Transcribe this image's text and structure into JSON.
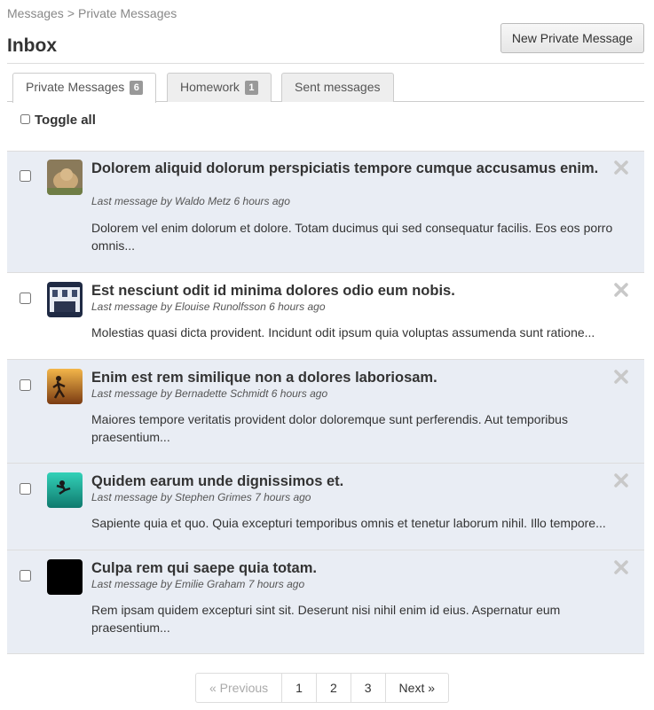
{
  "breadcrumb": {
    "parent": "Messages",
    "separator": ">",
    "current": "Private Messages"
  },
  "page_title": "Inbox",
  "new_button_label": "New Private Message",
  "tabs": [
    {
      "label": "Private Messages",
      "count": "6",
      "active": true
    },
    {
      "label": "Homework",
      "count": "1",
      "active": false
    },
    {
      "label": "Sent messages",
      "count": "",
      "active": false
    }
  ],
  "toggle_all_label": "Toggle all",
  "messages": [
    {
      "title": "Dolorem aliquid dolorum perspiciatis tempore cumque accusamus enim.",
      "meta": "Last message by Waldo Metz 6 hours ago",
      "body": "Dolorem vel enim dolorum et dolore. Totam ducimus qui sed consequatur facilis. Eos eos porro omnis...",
      "avatar": "avatar-dog",
      "shaded": true
    },
    {
      "title": "Est nesciunt odit id minima dolores odio eum nobis.",
      "meta": "Last message by Elouise Runolfsson 6 hours ago",
      "body": "Molestias quasi dicta provident. Incidunt odit ipsum quia voluptas assumenda sunt ratione...",
      "avatar": "avatar-building",
      "shaded": false
    },
    {
      "title": "Enim est rem similique non a dolores laboriosam.",
      "meta": "Last message by Bernadette Schmidt 6 hours ago",
      "body": "Maiores tempore veritatis provident dolor doloremque sunt perferendis. Aut temporibus praesentium...",
      "avatar": "avatar-sunset-runner",
      "shaded": true
    },
    {
      "title": "Quidem earum unde dignissimos et.",
      "meta": "Last message by Stephen Grimes 7 hours ago",
      "body": "Sapiente quia et quo. Quia excepturi temporibus omnis et tenetur laborum nihil. Illo tempore...",
      "avatar": "avatar-diver",
      "shaded": true
    },
    {
      "title": "Culpa rem qui saepe quia totam.",
      "meta": "Last message by Emilie Graham 7 hours ago",
      "body": "Rem ipsam quidem excepturi sint sit. Deserunt nisi nihil enim id eius. Aspernatur eum praesentium...",
      "avatar": "avatar-black",
      "shaded": true
    }
  ],
  "pagination": {
    "previous": "« Previous",
    "pages": [
      "1",
      "2",
      "3"
    ],
    "next": "Next »"
  },
  "colors": {
    "shaded_row": "#e9edf4",
    "badge": "#999999",
    "border": "#dddddd"
  }
}
